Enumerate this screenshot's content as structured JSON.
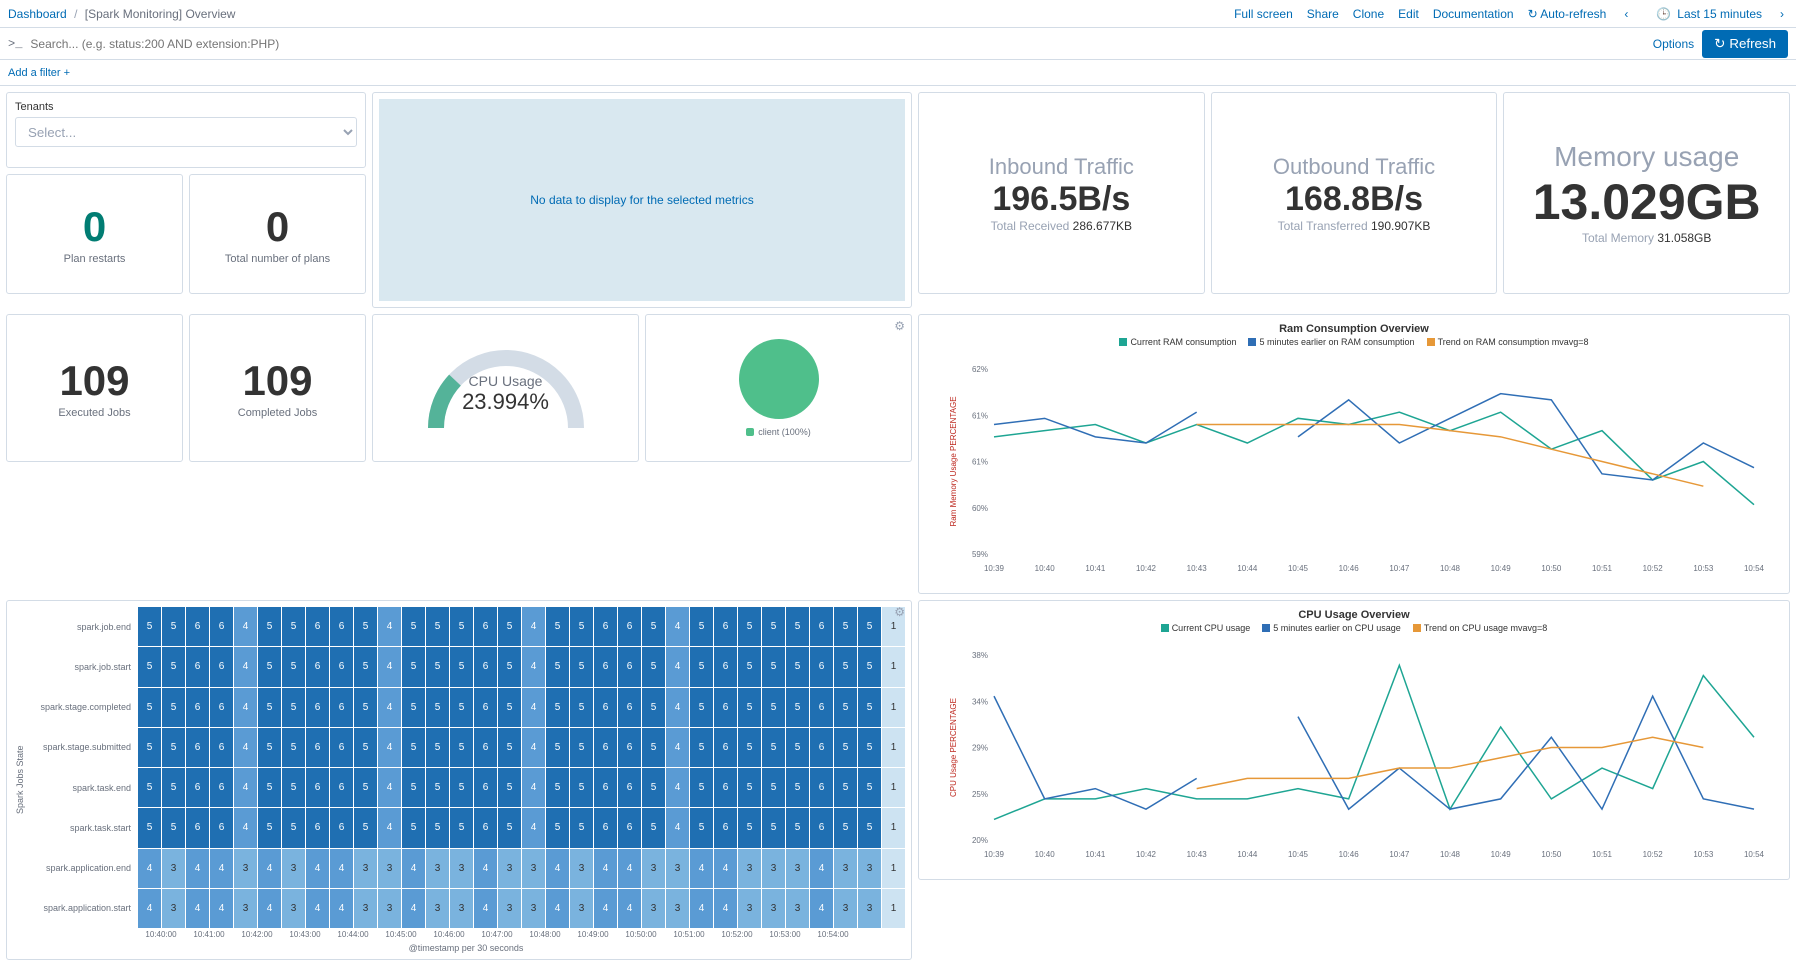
{
  "breadcrumb": {
    "root": "Dashboard",
    "current": "[Spark Monitoring] Overview"
  },
  "top_actions": {
    "full_screen": "Full screen",
    "share": "Share",
    "clone": "Clone",
    "edit": "Edit",
    "documentation": "Documentation",
    "auto_refresh": "Auto-refresh",
    "time_range": "Last 15 minutes"
  },
  "search": {
    "placeholder": "Search... (e.g. status:200 AND extension:PHP)",
    "options": "Options",
    "refresh": "Refresh"
  },
  "filter": {
    "add": "Add a filter +"
  },
  "tenants": {
    "label": "Tenants",
    "placeholder": "Select..."
  },
  "metrics": {
    "plan_restarts": {
      "value": "0",
      "label": "Plan restarts"
    },
    "total_plans": {
      "value": "0",
      "label": "Total number of plans"
    },
    "executed_jobs": {
      "value": "109",
      "label": "Executed Jobs"
    },
    "completed_jobs": {
      "value": "109",
      "label": "Completed Jobs"
    }
  },
  "nodata": "No data to display for the selected metrics",
  "traffic": {
    "inbound": {
      "title": "Inbound Traffic",
      "value": "196.5B/s",
      "sub_label": "Total Received",
      "sub_value": "286.677KB"
    },
    "outbound": {
      "title": "Outbound Traffic",
      "value": "168.8B/s",
      "sub_label": "Total Transferred",
      "sub_value": "190.907KB"
    },
    "memory": {
      "title": "Memory usage",
      "value": "13.029GB",
      "sub_label": "Total Memory",
      "sub_value": "31.058GB"
    }
  },
  "gauge": {
    "title": "CPU Usage",
    "value": "23.994%",
    "percent": 23.994
  },
  "pie": {
    "legend": "client (100%)"
  },
  "chart_data": [
    {
      "type": "line",
      "title": "Ram Consumption Overview",
      "ylabel": "Ram Memory Usage PERCENTAGE",
      "ylim": [
        59,
        62
      ],
      "x": [
        "10:39",
        "10:40",
        "10:41",
        "10:42",
        "10:43",
        "10:44",
        "10:45",
        "10:46",
        "10:47",
        "10:48",
        "10:49",
        "10:50",
        "10:51",
        "10:52",
        "10:53",
        "10:54"
      ],
      "series": [
        {
          "name": "Current RAM consumption",
          "color": "#1ea593",
          "values": [
            60.9,
            61.0,
            61.1,
            60.8,
            61.1,
            60.8,
            61.2,
            61.1,
            61.3,
            61.0,
            61.3,
            60.7,
            61.0,
            60.2,
            60.5,
            59.8
          ]
        },
        {
          "name": "5 minutes earlier on RAM consumption",
          "color": "#2f6eb5",
          "values": [
            61.1,
            61.2,
            60.9,
            60.8,
            61.3,
            null,
            60.9,
            61.5,
            60.8,
            61.2,
            61.6,
            61.5,
            60.3,
            60.2,
            60.8,
            60.4
          ]
        },
        {
          "name": "Trend on RAM consumption mvavg=8",
          "color": "#e69838",
          "values": [
            null,
            null,
            null,
            null,
            61.1,
            61.1,
            61.1,
            61.1,
            61.1,
            61.0,
            60.9,
            60.7,
            60.5,
            60.3,
            60.1,
            null
          ]
        }
      ]
    },
    {
      "type": "line",
      "title": "CPU Usage Overview",
      "ylabel": "CPU Usage PERCENTAGE",
      "ylim": [
        20,
        38
      ],
      "x": [
        "10:39",
        "10:40",
        "10:41",
        "10:42",
        "10:43",
        "10:44",
        "10:45",
        "10:46",
        "10:47",
        "10:48",
        "10:49",
        "10:50",
        "10:51",
        "10:52",
        "10:53",
        "10:54"
      ],
      "series": [
        {
          "name": "Current CPU usage",
          "color": "#1ea593",
          "values": [
            22,
            24,
            24,
            25,
            24,
            24,
            25,
            24,
            37,
            23,
            31,
            24,
            27,
            25,
            36,
            30
          ]
        },
        {
          "name": "5 minutes earlier on CPU usage",
          "color": "#2f6eb5",
          "values": [
            34,
            24,
            25,
            23,
            26,
            null,
            32,
            23,
            27,
            23,
            24,
            30,
            23,
            34,
            24,
            23
          ]
        },
        {
          "name": "Trend on CPU usage mvavg=8",
          "color": "#e69838",
          "values": [
            null,
            null,
            null,
            null,
            25,
            26,
            26,
            26,
            27,
            27,
            28,
            29,
            29,
            30,
            29,
            null
          ]
        }
      ]
    },
    {
      "type": "heatmap",
      "ylabel": "Spark Jobs State",
      "xlabel": "@timestamp per 30 seconds",
      "rows": [
        "spark.job.end",
        "spark.job.start",
        "spark.stage.completed",
        "spark.stage.submitted",
        "spark.task.end",
        "spark.task.start",
        "spark.application.end",
        "spark.application.start"
      ],
      "x_ticks": [
        "10:40:00",
        "10:41:00",
        "10:42:00",
        "10:43:00",
        "10:44:00",
        "10:45:00",
        "10:46:00",
        "10:47:00",
        "10:48:00",
        "10:49:00",
        "10:50:00",
        "10:51:00",
        "10:52:00",
        "10:53:00",
        "10:54:00"
      ],
      "pattern_a": [
        5,
        5,
        6,
        6,
        4,
        5,
        5,
        6,
        6,
        5,
        4,
        5,
        5,
        5,
        6,
        5,
        4,
        5,
        5,
        6,
        6,
        5,
        4,
        5,
        6,
        5,
        5,
        5,
        6,
        5,
        5,
        1
      ],
      "pattern_b": [
        4,
        3,
        4,
        4,
        3,
        4,
        3,
        4,
        4,
        3,
        3,
        4,
        3,
        3,
        4,
        3,
        3,
        4,
        3,
        4,
        4,
        3,
        3,
        4,
        4,
        3,
        3,
        3,
        4,
        3,
        3,
        1
      ]
    }
  ]
}
